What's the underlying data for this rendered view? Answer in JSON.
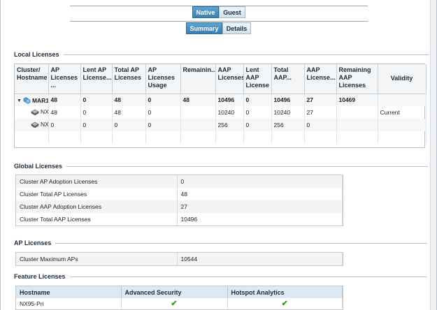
{
  "tabs": {
    "native": "Native",
    "guest": "Guest"
  },
  "subtabs": {
    "summary": "Summary",
    "details": "Details"
  },
  "local": {
    "title": "Local Licenses",
    "headers": [
      "Cluster/ Hostname",
      "AP Licenses ...",
      "Lent AP License...",
      "Total AP Licenses",
      "AP Licenses Usage",
      "Remainin...",
      "AAP Licenses",
      "Lent AAP License",
      "Total AAP...",
      "AAP License...",
      "Remaining AAP Licenses",
      "Validity"
    ],
    "rows": [
      {
        "name": "MAR1",
        "cells": [
          "48",
          "0",
          "48",
          "0",
          "48",
          "10496",
          "0",
          "10496",
          "27",
          "10469",
          ""
        ]
      },
      {
        "name": "NX",
        "cells": [
          "48",
          "0",
          "48",
          "0",
          "",
          "10240",
          "0",
          "10240",
          "27",
          "",
          "Current"
        ]
      },
      {
        "name": "NX",
        "cells": [
          "0",
          "0",
          "0",
          "0",
          "",
          "256",
          "0",
          "256",
          "0",
          "",
          ""
        ]
      }
    ]
  },
  "global": {
    "title": "Global Licenses",
    "rows": [
      {
        "label": "Cluster AP Adoption Licenses",
        "value": "0"
      },
      {
        "label": "Cluster Total AP Licenses",
        "value": "48"
      },
      {
        "label": "Cluster AAP Adoption Licenses",
        "value": "27"
      },
      {
        "label": "Cluster Total AAP Licenses",
        "value": "10496"
      }
    ]
  },
  "ap": {
    "title": "AP Licenses",
    "rows": [
      {
        "label": "Cluster Maximum APs",
        "value": "10544"
      }
    ]
  },
  "feature": {
    "title": "Feature Licenses",
    "headers": [
      "Hostname",
      "Advanced Security",
      "Hotspot Analytics"
    ],
    "rows": [
      {
        "hostname": "NX95-Pri",
        "advanced_security": "✔",
        "hotspot_analytics": "✔"
      }
    ]
  },
  "colors": {
    "accent": "#3d7fb0",
    "check": "#2f9e1f"
  }
}
